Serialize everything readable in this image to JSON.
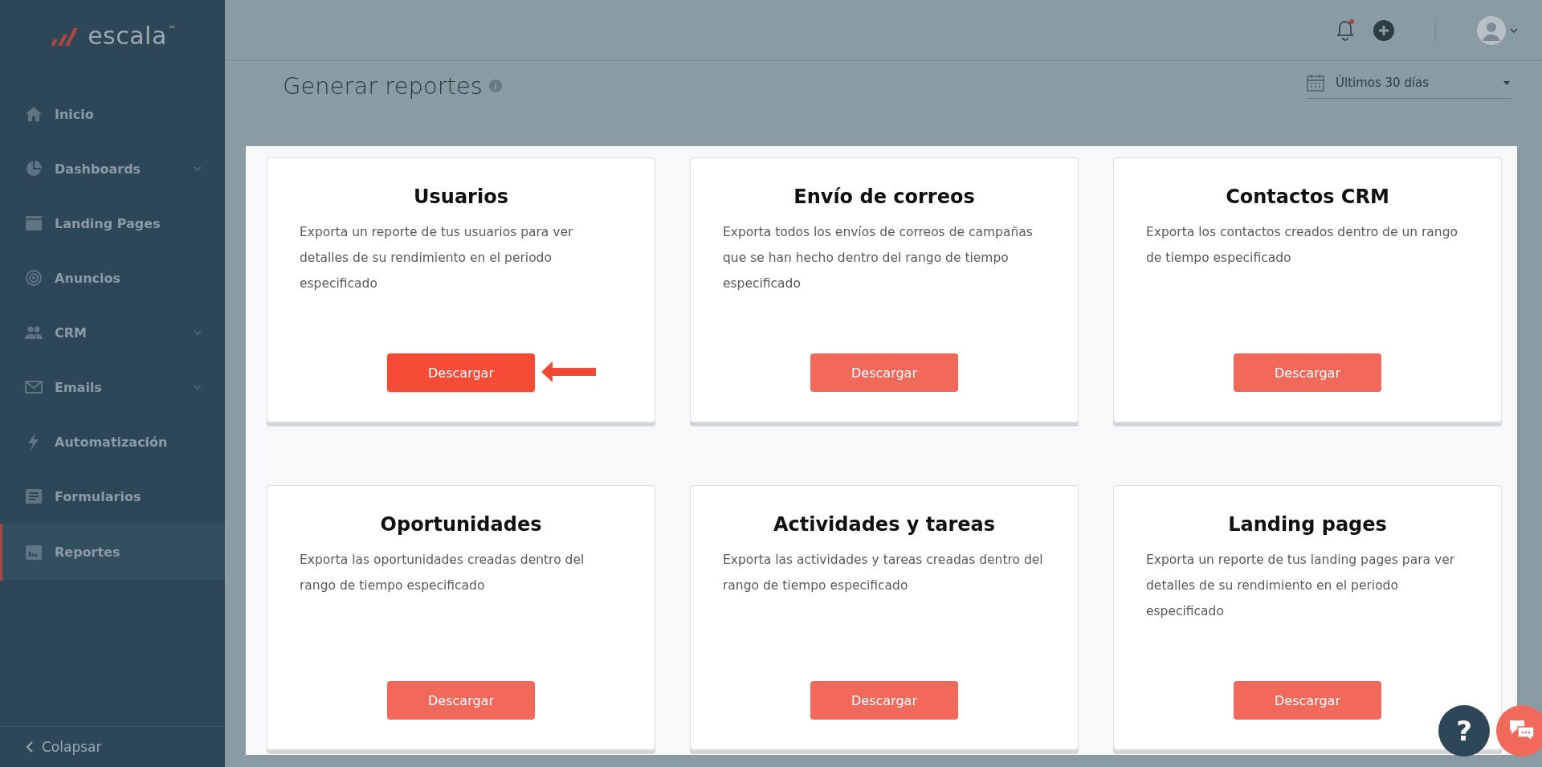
{
  "sidebar": {
    "logo": "escala",
    "trademark": "™",
    "items": [
      {
        "label": "Inicio",
        "kind": "home",
        "has_submenu": false,
        "selected": false
      },
      {
        "label": "Dashboards",
        "kind": "pie",
        "has_submenu": true,
        "selected": false
      },
      {
        "label": "Landing Pages",
        "kind": "window",
        "has_submenu": false,
        "selected": false
      },
      {
        "label": "Anuncios",
        "kind": "target",
        "has_submenu": false,
        "selected": false
      },
      {
        "label": "CRM",
        "kind": "people",
        "has_submenu": true,
        "selected": false
      },
      {
        "label": "Emails",
        "kind": "mail",
        "has_submenu": true,
        "selected": false
      },
      {
        "label": "Automatización",
        "kind": "bolt",
        "has_submenu": false,
        "selected": false
      },
      {
        "label": "Formularios",
        "kind": "form",
        "has_submenu": false,
        "selected": false
      },
      {
        "label": "Reportes",
        "kind": "chart",
        "has_submenu": false,
        "selected": true
      }
    ],
    "collapse": "Colapsar"
  },
  "header": {
    "notification_unread": true
  },
  "page": {
    "title": "Generar reportes",
    "date_range": "Últimos 30 días"
  },
  "cards": [
    {
      "title": "Usuarios",
      "description": "Exporta un reporte de tus usuarios para ver detalles de su rendimiento en el periodo especificado",
      "button": "Descargar",
      "highlighted": true
    },
    {
      "title": "Envío de correos",
      "description": "Exporta todos los envíos de correos de campañas que se han hecho dentro del rango de tiempo especificado",
      "button": "Descargar",
      "highlighted": false
    },
    {
      "title": "Contactos CRM",
      "description": "Exporta los contactos creados dentro de un rango de tiempo especificado",
      "button": "Descargar",
      "highlighted": false
    },
    {
      "title": "Oportunidades",
      "description": "Exporta las oportunidades creadas dentro del rango de tiempo especificado",
      "button": "Descargar",
      "highlighted": false
    },
    {
      "title": "Actividades y tareas",
      "description": "Exporta las actividades y tareas creadas dentro del rango de tiempo especificado",
      "button": "Descargar",
      "highlighted": false
    },
    {
      "title": "Landing pages",
      "description": "Exporta un reporte de tus landing pages para ver detalles de su rendimiento en el periodo especificado",
      "button": "Descargar",
      "highlighted": false
    }
  ],
  "help_button": "?"
}
